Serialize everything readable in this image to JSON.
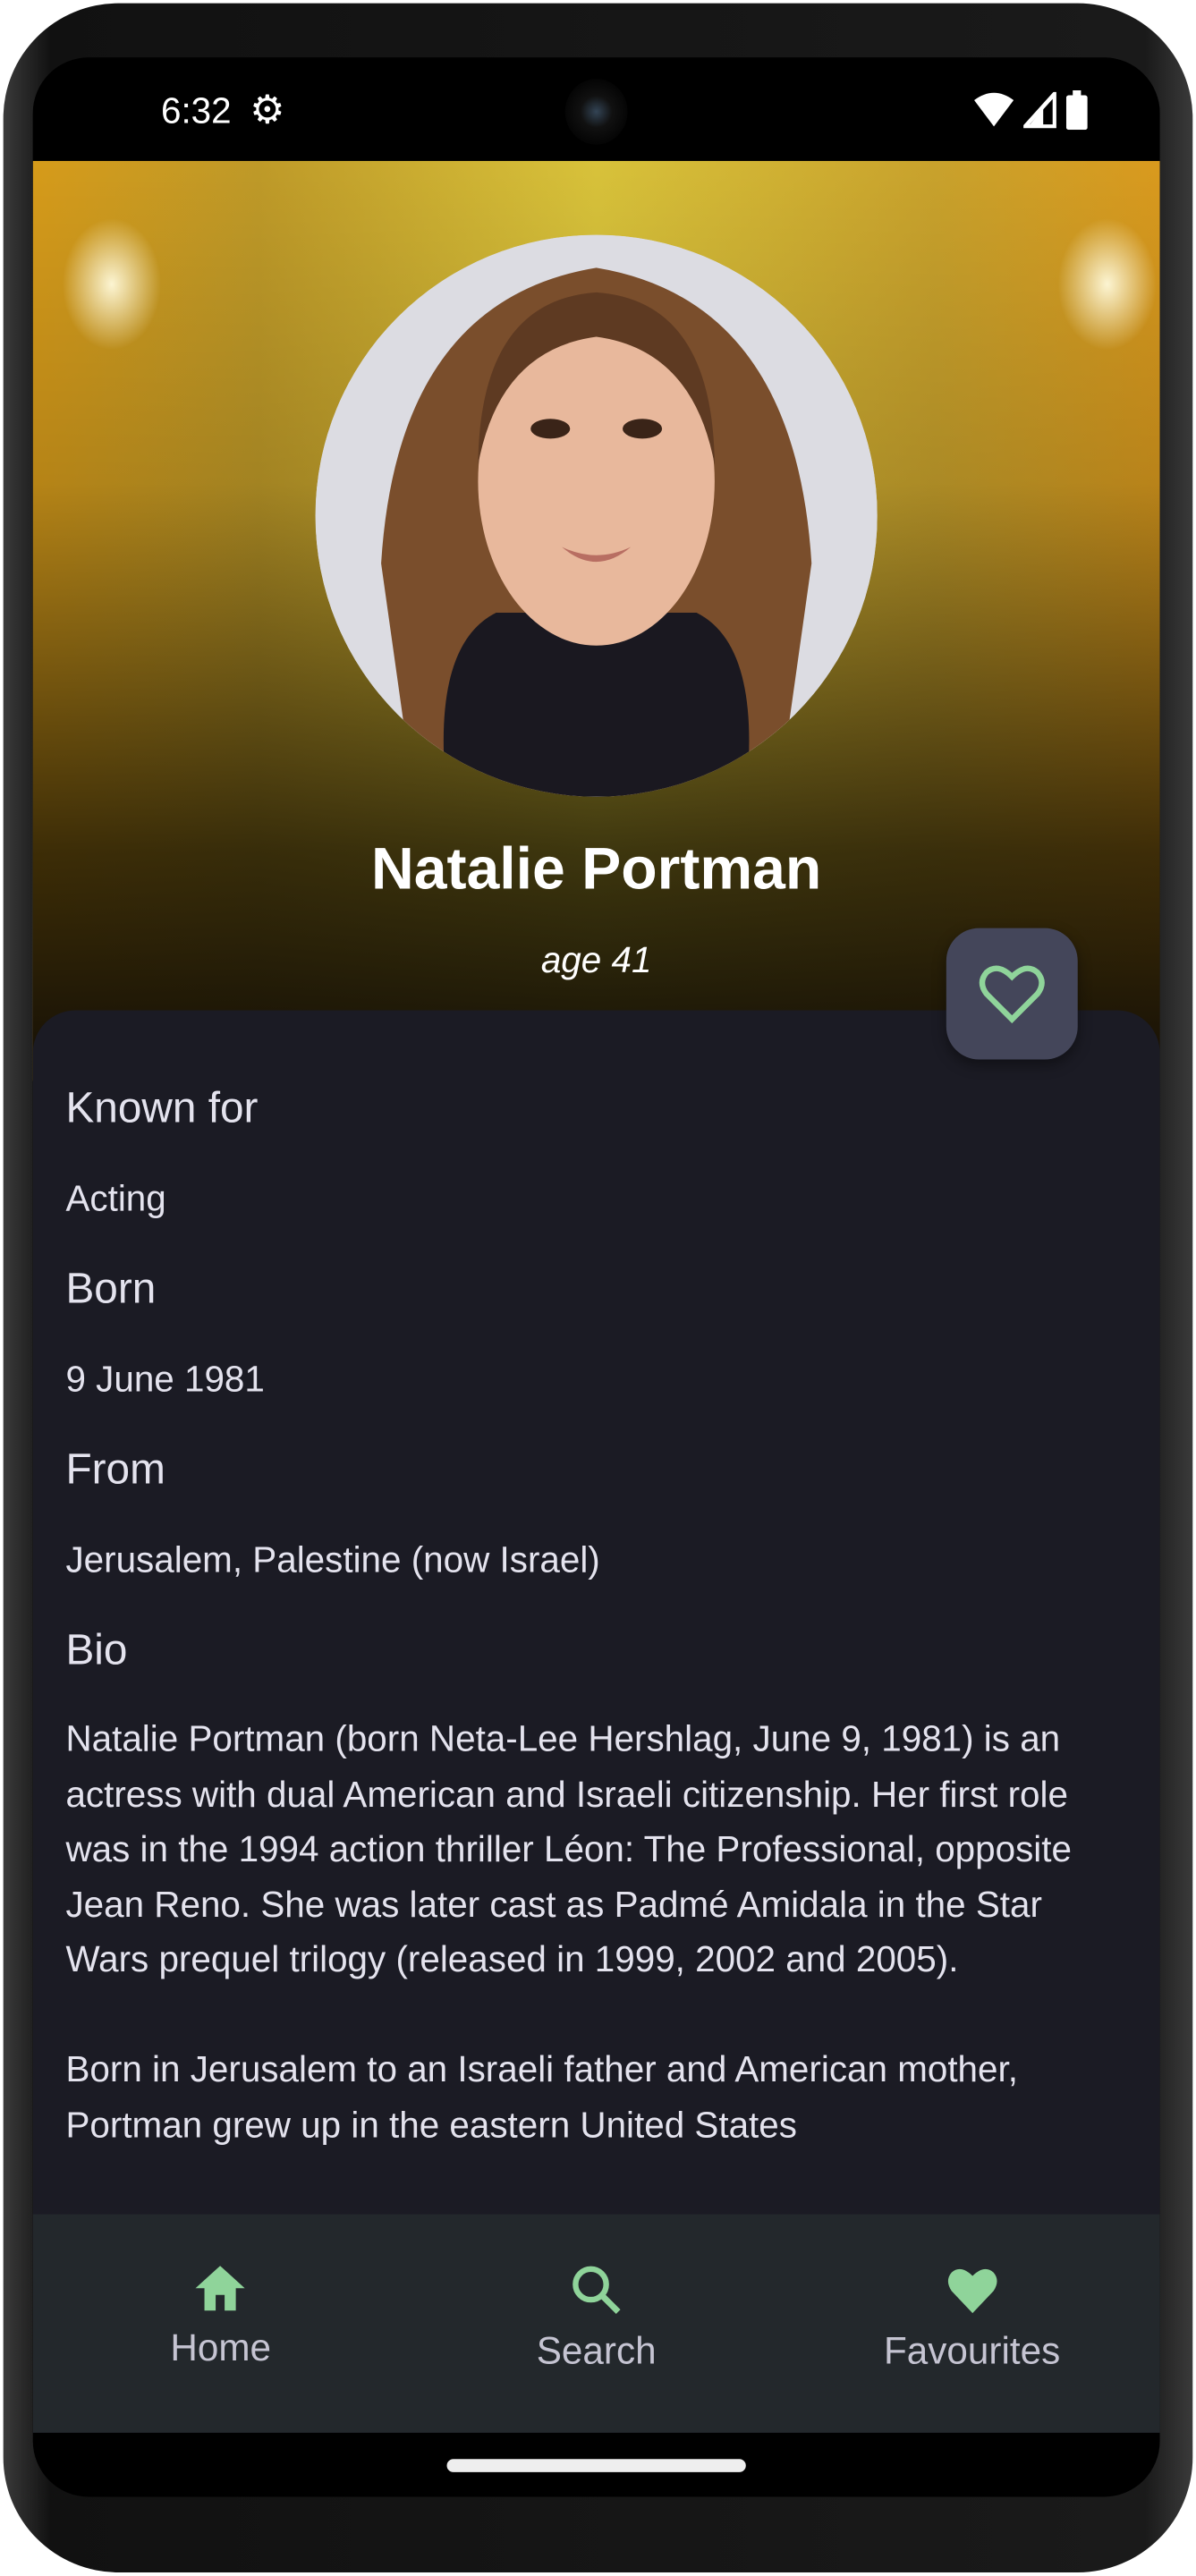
{
  "status_bar": {
    "time": "6:32",
    "icons": [
      "gear-icon",
      "wifi-icon",
      "signal-icon",
      "battery-icon"
    ]
  },
  "profile": {
    "name": "Natalie Portman",
    "age": "age 41",
    "favourite_icon": "heart-outline-icon"
  },
  "details": [
    {
      "label": "Known for",
      "value": "Acting"
    },
    {
      "label": "Born",
      "value": "9 June 1981"
    },
    {
      "label": "From",
      "value": "Jerusalem, Palestine (now Israel)"
    }
  ],
  "bio": {
    "label": "Bio",
    "paragraphs": [
      "Natalie Portman (born Neta-Lee Hershlag, June 9, 1981) is an actress with dual American and Israeli citizenship. Her first role was in the 1994 action thriller Léon: The Professional, opposite Jean Reno. She was later cast as Padmé Amidala in the Star Wars prequel trilogy (released in 1999, 2002 and 2005).",
      "Born in Jerusalem to an Israeli father and American mother, Portman grew up in the eastern United States"
    ]
  },
  "bottom_nav": [
    {
      "label": "Home",
      "icon": "home-icon"
    },
    {
      "label": "Search",
      "icon": "search-icon"
    },
    {
      "label": "Favourites",
      "icon": "heart-icon"
    }
  ],
  "colors": {
    "accent": "#8fd49a",
    "card": "#1b1b24",
    "nav": "#23282c",
    "fab": "#44465a"
  }
}
